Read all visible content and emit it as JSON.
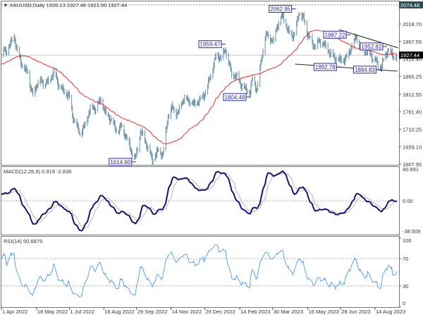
{
  "header": {
    "icon": "triangle-down-icon",
    "symbol": "XAUUSD,Daily",
    "ohlc": "1926.13 1927.48 1923.96 1927.44"
  },
  "macd_panel": {
    "label": "MACD(12,26,9) 0.919 -2.836"
  },
  "rsi_panel": {
    "label": "RSI(14) 50.6879"
  },
  "colors": {
    "bars": "#6e93aa",
    "ma": "#e8302e",
    "macd": "#15157a",
    "signal": "#b8b8b8",
    "rsi": "#3c8ee8",
    "label_box": "#2a2aa0",
    "last_price_tag": "#000000",
    "top_tag": "#2f4f4f"
  },
  "chart_data": {
    "type": "ohlc",
    "symbol": "XAUUSD",
    "timeframe": "Daily",
    "price_axis": {
      "ticks": [
        "2018.70",
        "1967.55",
        "1916.40",
        "1865.25",
        "1812.55",
        "1761.40",
        "1710.25",
        "1659.10",
        "1607.95"
      ],
      "range": [
        1607.95,
        2074.48
      ],
      "top_marker": "2074.48",
      "last_price": "1927.44"
    },
    "date_axis": {
      "labels": [
        "1 Apr 2022",
        "18 May 2022",
        "1 Jul 2022",
        "16 Aug 2022",
        "29 Sep 2022",
        "14 Nov 2022",
        "29 Dec 2022",
        "14 Feb 2023",
        "30 Mar 2023",
        "16 May 2023",
        "29 Jun 2023",
        "14 Aug 2023"
      ]
    },
    "close_keypoints": [
      [
        "2022-04-01",
        1925
      ],
      [
        "2022-04-08",
        1945
      ],
      [
        "2022-04-18",
        1985
      ],
      [
        "2022-04-22",
        1932
      ],
      [
        "2022-04-29",
        1896
      ],
      [
        "2022-05-06",
        1882
      ],
      [
        "2022-05-13",
        1805
      ],
      [
        "2022-05-20",
        1845
      ],
      [
        "2022-05-27",
        1852
      ],
      [
        "2022-06-03",
        1850
      ],
      [
        "2022-06-10",
        1872
      ],
      [
        "2022-06-17",
        1840
      ],
      [
        "2022-06-24",
        1826
      ],
      [
        "2022-06-30",
        1807
      ],
      [
        "2022-07-06",
        1740
      ],
      [
        "2022-07-14",
        1706
      ],
      [
        "2022-07-21",
        1718
      ],
      [
        "2022-07-29",
        1765
      ],
      [
        "2022-08-05",
        1775
      ],
      [
        "2022-08-12",
        1802
      ],
      [
        "2022-08-19",
        1747
      ],
      [
        "2022-08-26",
        1737
      ],
      [
        "2022-09-02",
        1712
      ],
      [
        "2022-09-09",
        1716
      ],
      [
        "2022-09-16",
        1675
      ],
      [
        "2022-09-27",
        1626
      ],
      [
        "2022-10-04",
        1700
      ],
      [
        "2022-10-12",
        1665
      ],
      [
        "2022-10-20",
        1627
      ],
      [
        "2022-10-28",
        1645
      ],
      [
        "2022-11-03",
        1630
      ],
      [
        "2022-11-10",
        1755
      ],
      [
        "2022-11-15",
        1776
      ],
      [
        "2022-11-23",
        1750
      ],
      [
        "2022-12-01",
        1803
      ],
      [
        "2022-12-09",
        1797
      ],
      [
        "2022-12-15",
        1778
      ],
      [
        "2022-12-23",
        1795
      ],
      [
        "2022-12-30",
        1824
      ],
      [
        "2023-01-06",
        1865
      ],
      [
        "2023-01-13",
        1920
      ],
      [
        "2023-01-20",
        1926
      ],
      [
        "2023-01-26",
        1946
      ],
      [
        "2023-02-03",
        1865
      ],
      [
        "2023-02-10",
        1865
      ],
      [
        "2023-02-17",
        1842
      ],
      [
        "2023-02-27",
        1810
      ],
      [
        "2023-03-03",
        1855
      ],
      [
        "2023-03-09",
        1831
      ],
      [
        "2023-03-15",
        1918
      ],
      [
        "2023-03-20",
        1980
      ],
      [
        "2023-03-24",
        1978
      ],
      [
        "2023-03-31",
        1969
      ],
      [
        "2023-04-05",
        2020
      ],
      [
        "2023-04-13",
        2040
      ],
      [
        "2023-04-19",
        1995
      ],
      [
        "2023-04-28",
        1990
      ],
      [
        "2023-05-04",
        2050
      ],
      [
        "2023-05-10",
        2030
      ],
      [
        "2023-05-16",
        1990
      ],
      [
        "2023-05-24",
        1958
      ],
      [
        "2023-05-31",
        1962
      ],
      [
        "2023-06-05",
        1960
      ],
      [
        "2023-06-13",
        1944
      ],
      [
        "2023-06-22",
        1914
      ],
      [
        "2023-06-29",
        1908
      ],
      [
        "2023-07-07",
        1925
      ],
      [
        "2023-07-14",
        1955
      ],
      [
        "2023-07-20",
        1975
      ],
      [
        "2023-07-27",
        1945
      ],
      [
        "2023-08-04",
        1942
      ],
      [
        "2023-08-11",
        1915
      ],
      [
        "2023-08-21",
        1892
      ],
      [
        "2023-08-25",
        1915
      ],
      [
        "2023-08-31",
        1942
      ],
      [
        "2023-09-07",
        1918
      ],
      [
        "2023-09-12",
        1927.44
      ]
    ],
    "price_labels": [
      {
        "text": "1614.60",
        "date": "2022-09-28",
        "price": 1614.6
      },
      {
        "text": "1959.47",
        "date": "2023-01-26",
        "price": 1959.47
      },
      {
        "text": "1804.48",
        "date": "2023-02-28",
        "price": 1804.48
      },
      {
        "text": "2062.95",
        "date": "2023-04-30",
        "price": 2062.95
      },
      {
        "text": "1987.22",
        "date": "2023-07-12",
        "price": 1987.22
      },
      {
        "text": "1892.78",
        "date": "2023-06-29",
        "price": 1892.78
      },
      {
        "text": "1884.83",
        "date": "2023-08-21",
        "price": 1884.83
      },
      {
        "text": "1952.82",
        "date": "2023-08-30",
        "price": 1952.82
      }
    ],
    "trendlines": [
      {
        "from": [
          "2023-06-27",
          2002
        ],
        "to": [
          "2023-09-14",
          1948.6
        ]
      },
      {
        "from": [
          "2023-04-29",
          1901
        ],
        "to": [
          "2023-09-13",
          1880.5
        ]
      }
    ],
    "moving_average": {
      "type": "SMA",
      "period": 50
    },
    "macd": {
      "params": [
        12,
        26,
        9
      ],
      "value": 0.919,
      "signal": -2.836,
      "axis_ticks": [
        "40.691",
        "0.00",
        "-38.509"
      ],
      "range": [
        -38.509,
        40.691
      ]
    },
    "rsi": {
      "period": 14,
      "value": 50.6879,
      "axis_ticks": [
        "100",
        "70",
        "30",
        "0"
      ],
      "levels": [
        70,
        30
      ],
      "range": [
        0,
        100
      ]
    }
  }
}
